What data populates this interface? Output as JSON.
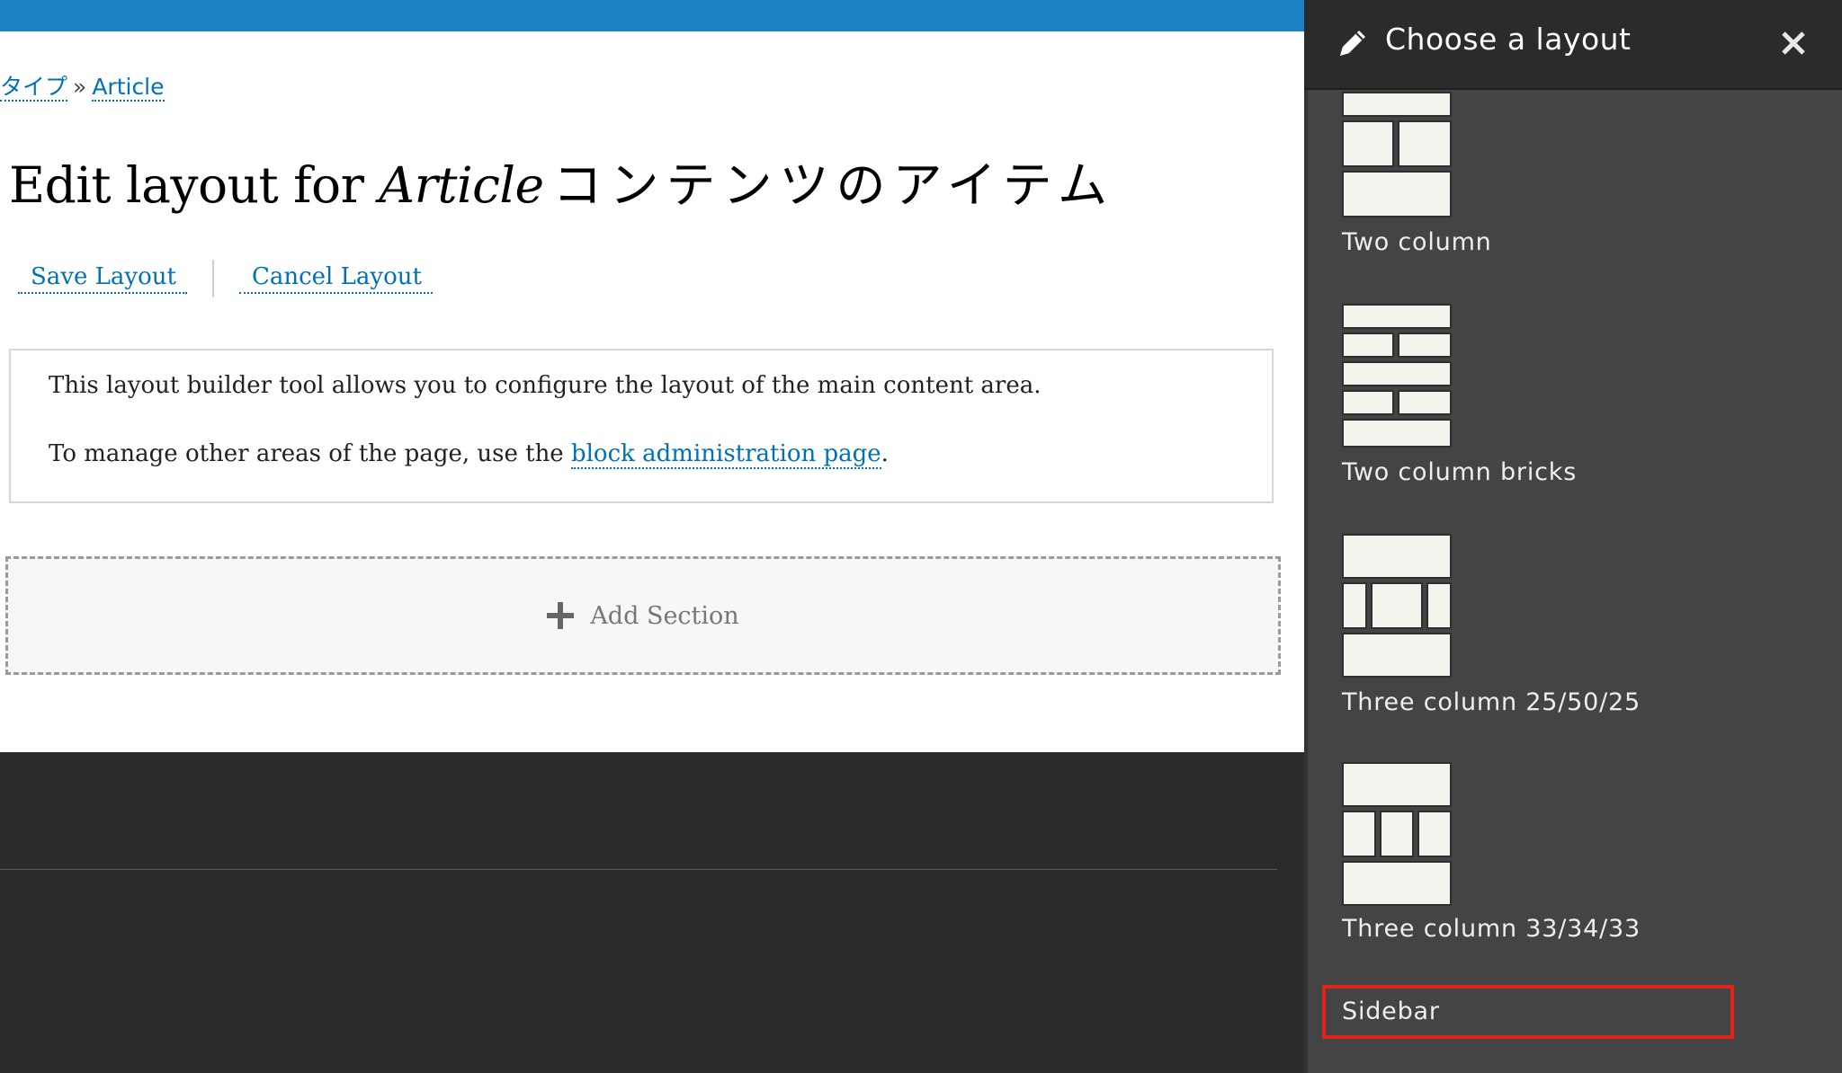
{
  "breadcrumb": {
    "items": [
      "タイプ",
      "Article"
    ],
    "separator": "»"
  },
  "page": {
    "title_prefix": "Edit layout for ",
    "title_entity": "Article",
    "title_suffix": "コンテンツのアイテム"
  },
  "actions": {
    "save_label": "Save Layout",
    "cancel_label": "Cancel Layout"
  },
  "message": {
    "line1": "This layout builder tool allows you to configure the layout of the main content area.",
    "line2_prefix": "To manage other areas of the page, use the ",
    "line2_link": "block administration page",
    "line2_suffix": "."
  },
  "add_section": {
    "label": "Add Section"
  },
  "offcanvas": {
    "title": "Choose a layout",
    "layouts": [
      {
        "label": "Two column",
        "icon": "two-column-layout-icon"
      },
      {
        "label": "Two column bricks",
        "icon": "two-column-bricks-layout-icon"
      },
      {
        "label": "Three column 25/50/25",
        "icon": "three-column-25-50-25-layout-icon"
      },
      {
        "label": "Three column 33/34/33",
        "icon": "three-column-33-34-33-layout-icon"
      },
      {
        "label": "Sidebar",
        "icon": ""
      }
    ]
  },
  "colors": {
    "topbar": "#1a82c3",
    "link": "#0071b3",
    "offcanvas_bg": "#444444",
    "offcanvas_header": "#2b2b2b",
    "highlight": "#e2231a"
  }
}
